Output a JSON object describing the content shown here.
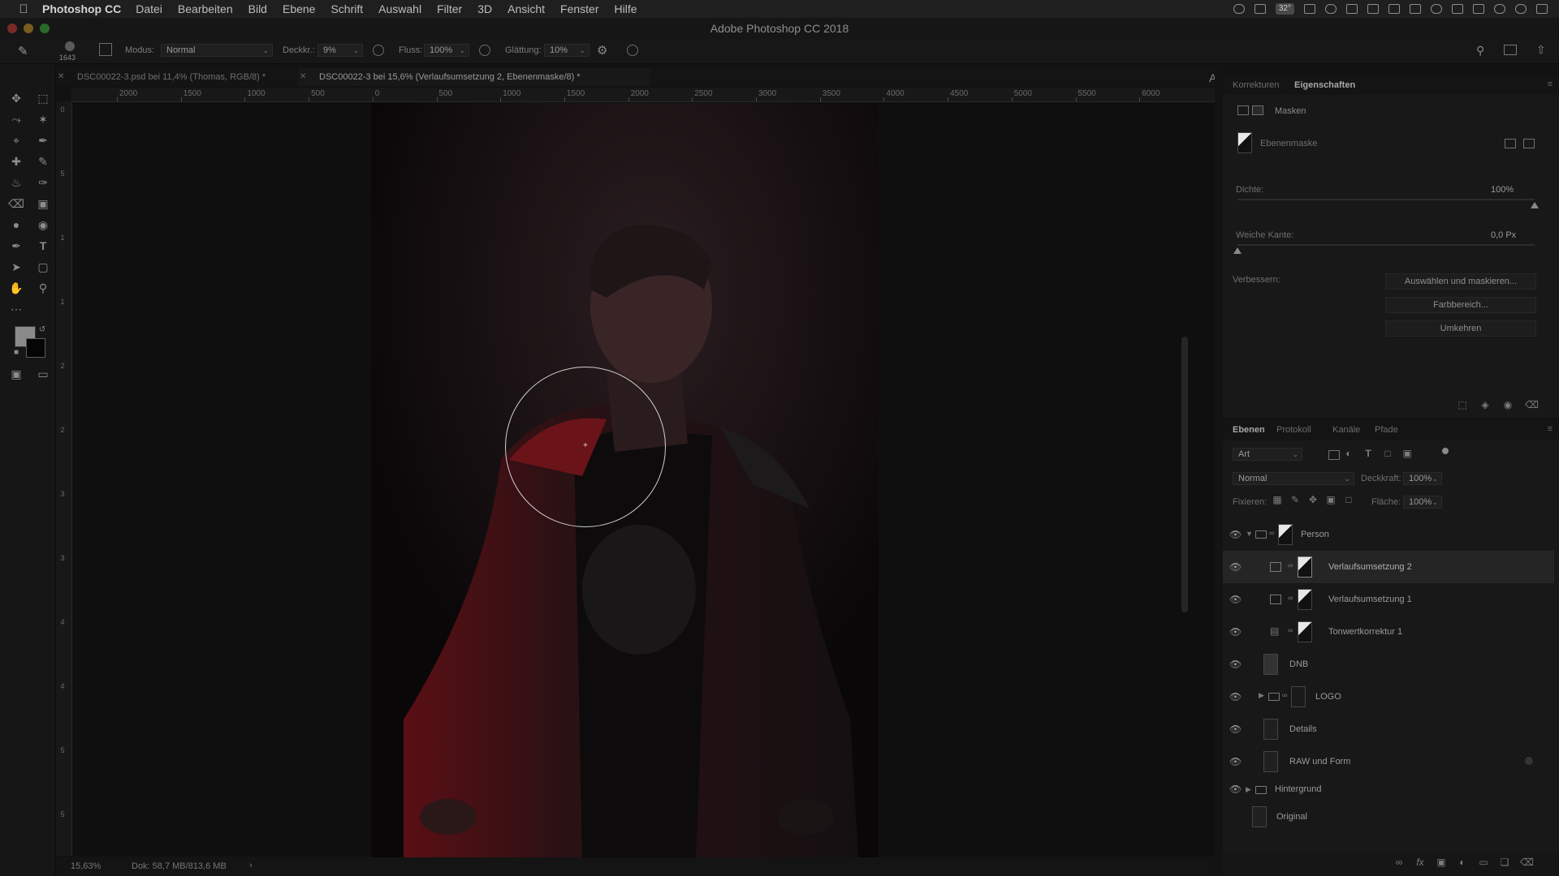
{
  "menubar": {
    "app": "Photoshop CC",
    "items": [
      "Datei",
      "Bearbeiten",
      "Bild",
      "Ebene",
      "Schrift",
      "Auswahl",
      "Filter",
      "3D",
      "Ansicht",
      "Fenster",
      "Hilfe"
    ],
    "tray_temp": "32°"
  },
  "window": {
    "title": "Adobe Photoshop CC 2018"
  },
  "options": {
    "brush_size": "1643",
    "modus_label": "Modus:",
    "modus_value": "Normal",
    "deckkr_label": "Deckkr.:",
    "deckkr_value": "9%",
    "fluss_label": "Fluss:",
    "fluss_value": "100%",
    "glaettung_label": "Glättung:",
    "glaettung_value": "10%"
  },
  "tabs": [
    {
      "label": "DSC00022-3.psd bei 11,4% (Thomas, RGB/8) *"
    },
    {
      "label": "DSC00022-3 bei 15,6% (Verlaufsumsetzung 2, Ebenenmaske/8) *"
    }
  ],
  "ruler_h": [
    "2000",
    "1500",
    "1000",
    "500",
    "0",
    "500",
    "1000",
    "1500",
    "2000",
    "2500",
    "3000",
    "3500",
    "4000",
    "4500",
    "5000",
    "5500",
    "6000"
  ],
  "ruler_v": [
    "0",
    "5",
    "1",
    "1",
    "2",
    "2",
    "3",
    "3",
    "4",
    "4",
    "5",
    "5"
  ],
  "status": {
    "zoom": "15,63%",
    "doc": "Dok: 58,7 MB/813,6 MB"
  },
  "properties": {
    "tabs": [
      "Korrekturen",
      "Eigenschaften"
    ],
    "masks_label": "Masken",
    "mask_type": "Ebenenmaske",
    "dichte_label": "Dichte:",
    "dichte_value": "100%",
    "dichte_level": 1.0,
    "kante_label": "Weiche Kante:",
    "kante_value": "0,0 Px",
    "kante_level": 0.0,
    "verbessern_label": "Verbessern:",
    "buttons": [
      "Auswählen und maskieren...",
      "Farbbereich...",
      "Umkehren"
    ]
  },
  "layers_panel": {
    "tabs": [
      "Ebenen",
      "Protokoll",
      "Kanäle",
      "Pfade"
    ],
    "filter_value": "Art",
    "blend_mode": "Normal",
    "opacity_label": "Deckkraft:",
    "opacity_value": "100%",
    "lock_label": "Fixieren:",
    "fill_label": "Fläche:",
    "fill_value": "100%",
    "layers": [
      {
        "name": "Person"
      },
      {
        "name": "Verlaufsumsetzung 2"
      },
      {
        "name": "Verlaufsumsetzung 1"
      },
      {
        "name": "Tonwertkorrektur 1"
      },
      {
        "name": "DNB"
      },
      {
        "name": "LOGO"
      },
      {
        "name": "Details"
      },
      {
        "name": "RAW und Form"
      },
      {
        "name": "Hintergrund"
      },
      {
        "name": "Original"
      }
    ]
  },
  "colors": {
    "accent_red": "#7a1418",
    "panel_bg": "#181818",
    "canvas_bg": "#0f0f0f"
  }
}
